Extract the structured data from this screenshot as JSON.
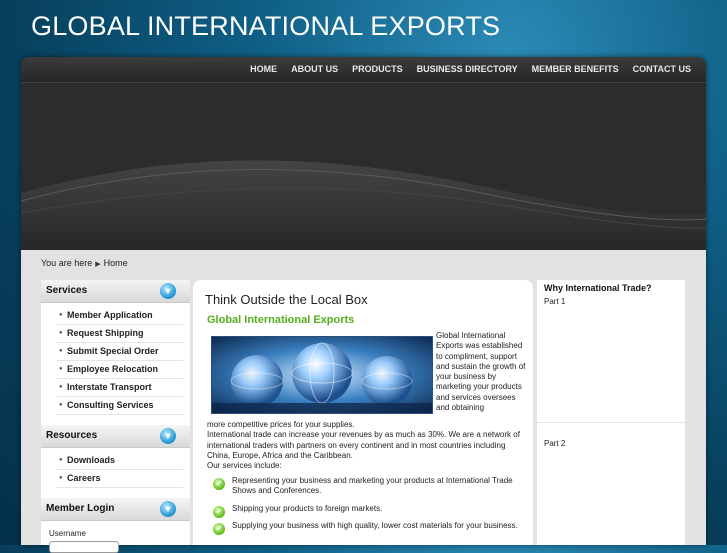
{
  "site": {
    "title": "GLOBAL INTERNATIONAL EXPORTS"
  },
  "nav": [
    "HOME",
    "ABOUT US",
    "PRODUCTS",
    "BUSINESS DIRECTORY",
    "MEMBER BENEFITS",
    "CONTACT US"
  ],
  "breadcrumb": {
    "prefix": "You are here",
    "current": "Home"
  },
  "sidebar": {
    "services": {
      "title": "Services",
      "items": [
        "Member Application",
        "Request Shipping",
        "Submit Special Order",
        "Employee Relocation",
        "Interstate Transport",
        "Consulting Services"
      ]
    },
    "resources": {
      "title": "Resources",
      "items": [
        "Downloads",
        "Careers"
      ]
    },
    "login": {
      "title": "Member Login",
      "username_label": "Username"
    }
  },
  "main": {
    "heading": "Think Outside the Local Box",
    "subheading": "Global International Exports",
    "intro_side": "Global International Exports was established to compliment, support and sustain the growth of your business by marketing your products and services oversees and obtaining",
    "intro_cont_1": "more competitive prices for your supplies.",
    "intro_cont_2": "International trade can increase your revenues by as much as 30%. We are a network of international traders with partners on every continent and in most countries including China, Europe, Africa and the Caribbean.",
    "intro_cont_3": "Our services include:",
    "services": [
      "Representing your business and marketing your products at International Trade Shows and Conferences.",
      "Shipping your products to foreign markets.",
      "Supplying your business with high quality, lower cost materials for your business."
    ]
  },
  "right": {
    "title": "Why International Trade?",
    "part1": "Part 1",
    "part2": "Part 2"
  },
  "colors": {
    "accent_green": "#55b01e",
    "brand_blue": "#0f5f86"
  }
}
